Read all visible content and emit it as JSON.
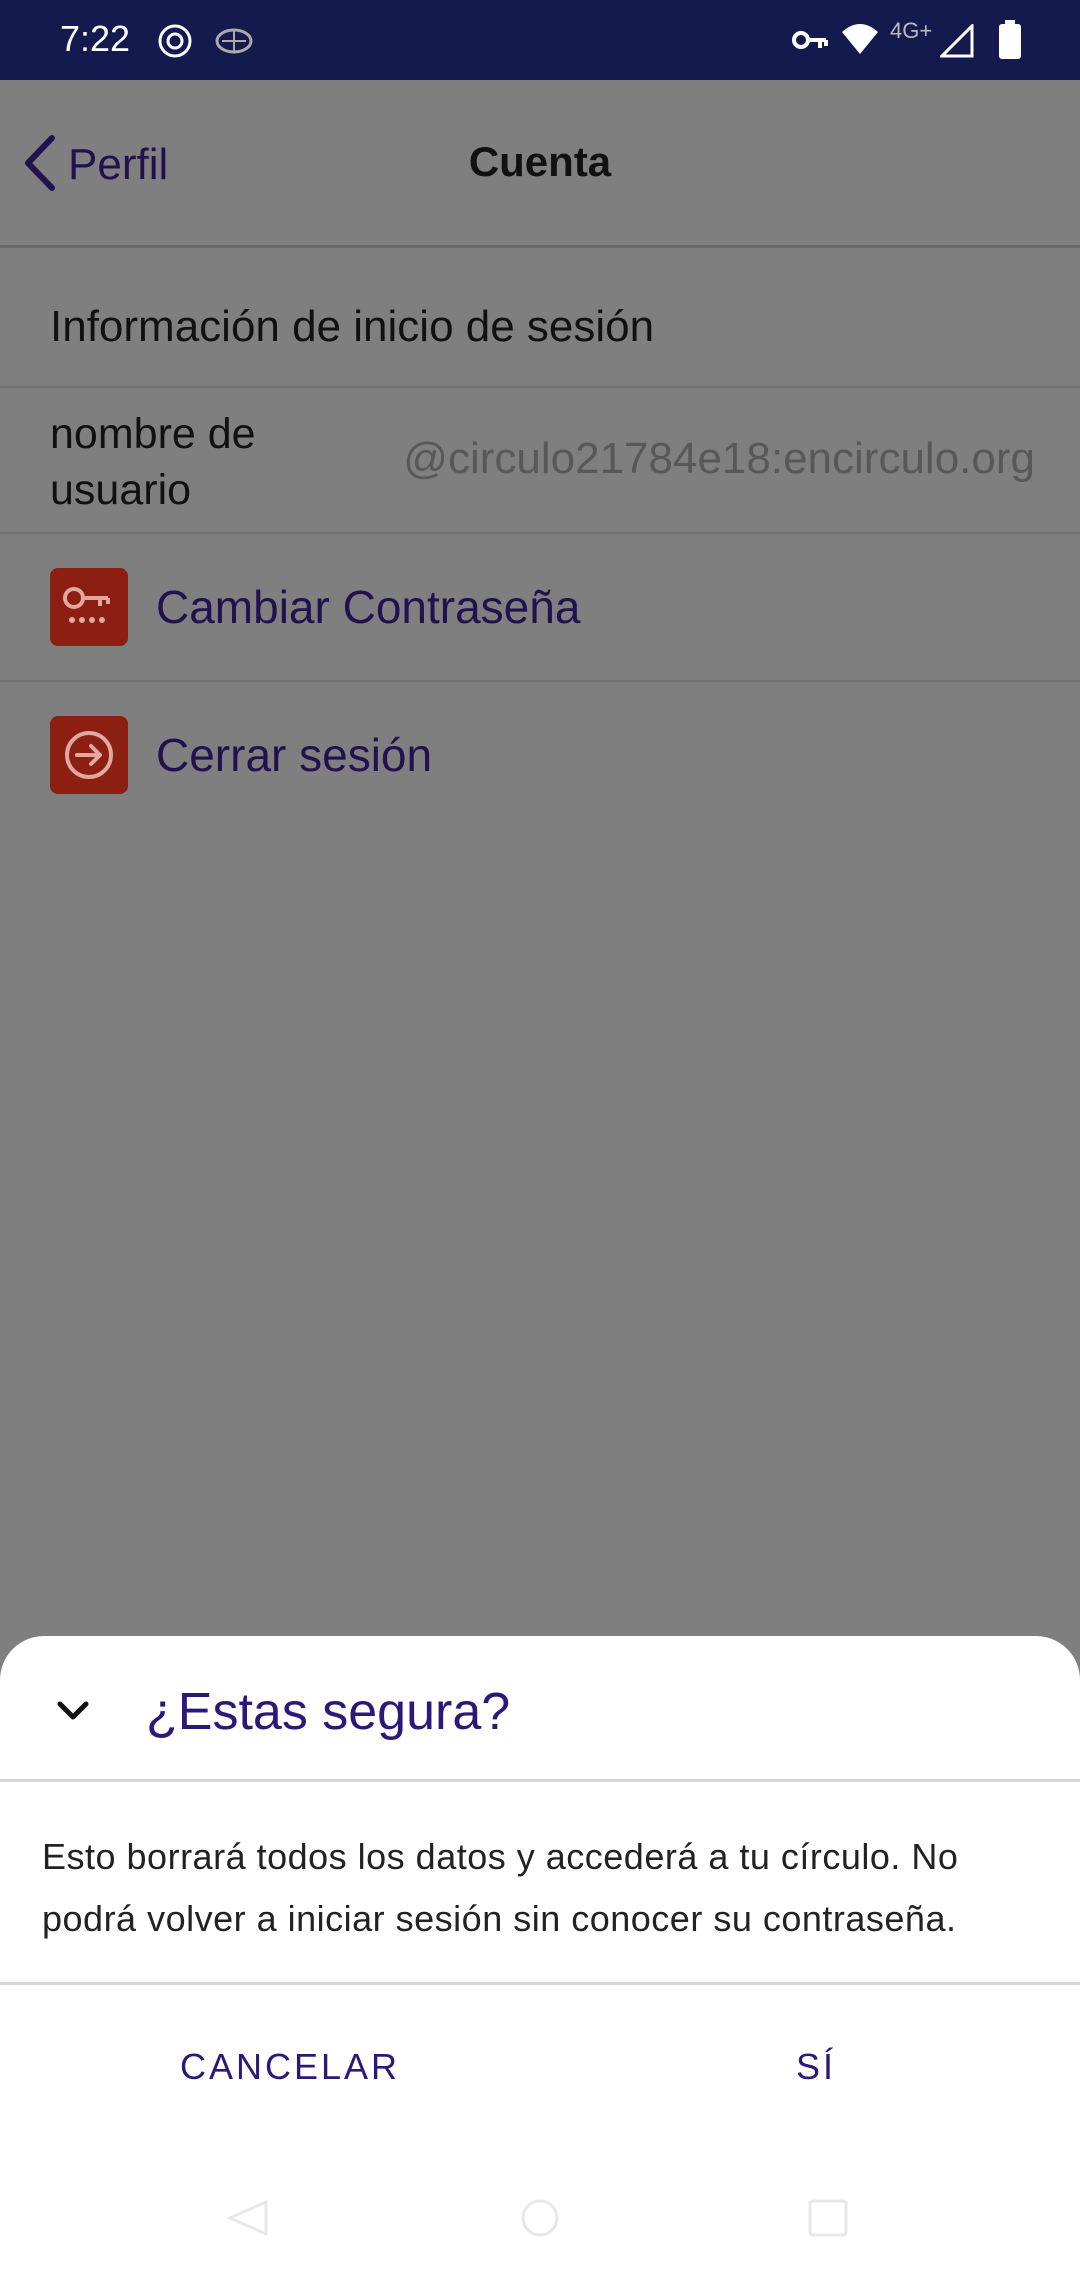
{
  "status_bar": {
    "time": "7:22",
    "network_label": "4G+",
    "icons": [
      "openai-icon",
      "brain-icon",
      "vpn-key-icon",
      "wifi-icon",
      "signal-icon",
      "battery-icon"
    ]
  },
  "nav": {
    "back_label": "Perfil",
    "title": "Cuenta"
  },
  "account": {
    "section_title": "Información de inicio de sesión",
    "username_label": "nombre de usuario",
    "username_value": "@circulo21784e18:encirculo.org",
    "actions": [
      {
        "label": "Cambiar Contraseña",
        "icon": "key-icon"
      },
      {
        "label": "Cerrar sesión",
        "icon": "logout-icon"
      }
    ]
  },
  "dialog": {
    "title": "¿Estas segura?",
    "message": "Esto borrará todos los datos y accederá a tu círculo. No podrá volver a iniciar sesión sin conocer su contraseña.",
    "cancel_label": "CANCELAR",
    "confirm_label": "SÍ"
  },
  "colors": {
    "status_bar": "#141a4d",
    "accent": "#2b1878",
    "icon_bg": "#8c1f12",
    "scrim": "#7f7f7f"
  }
}
